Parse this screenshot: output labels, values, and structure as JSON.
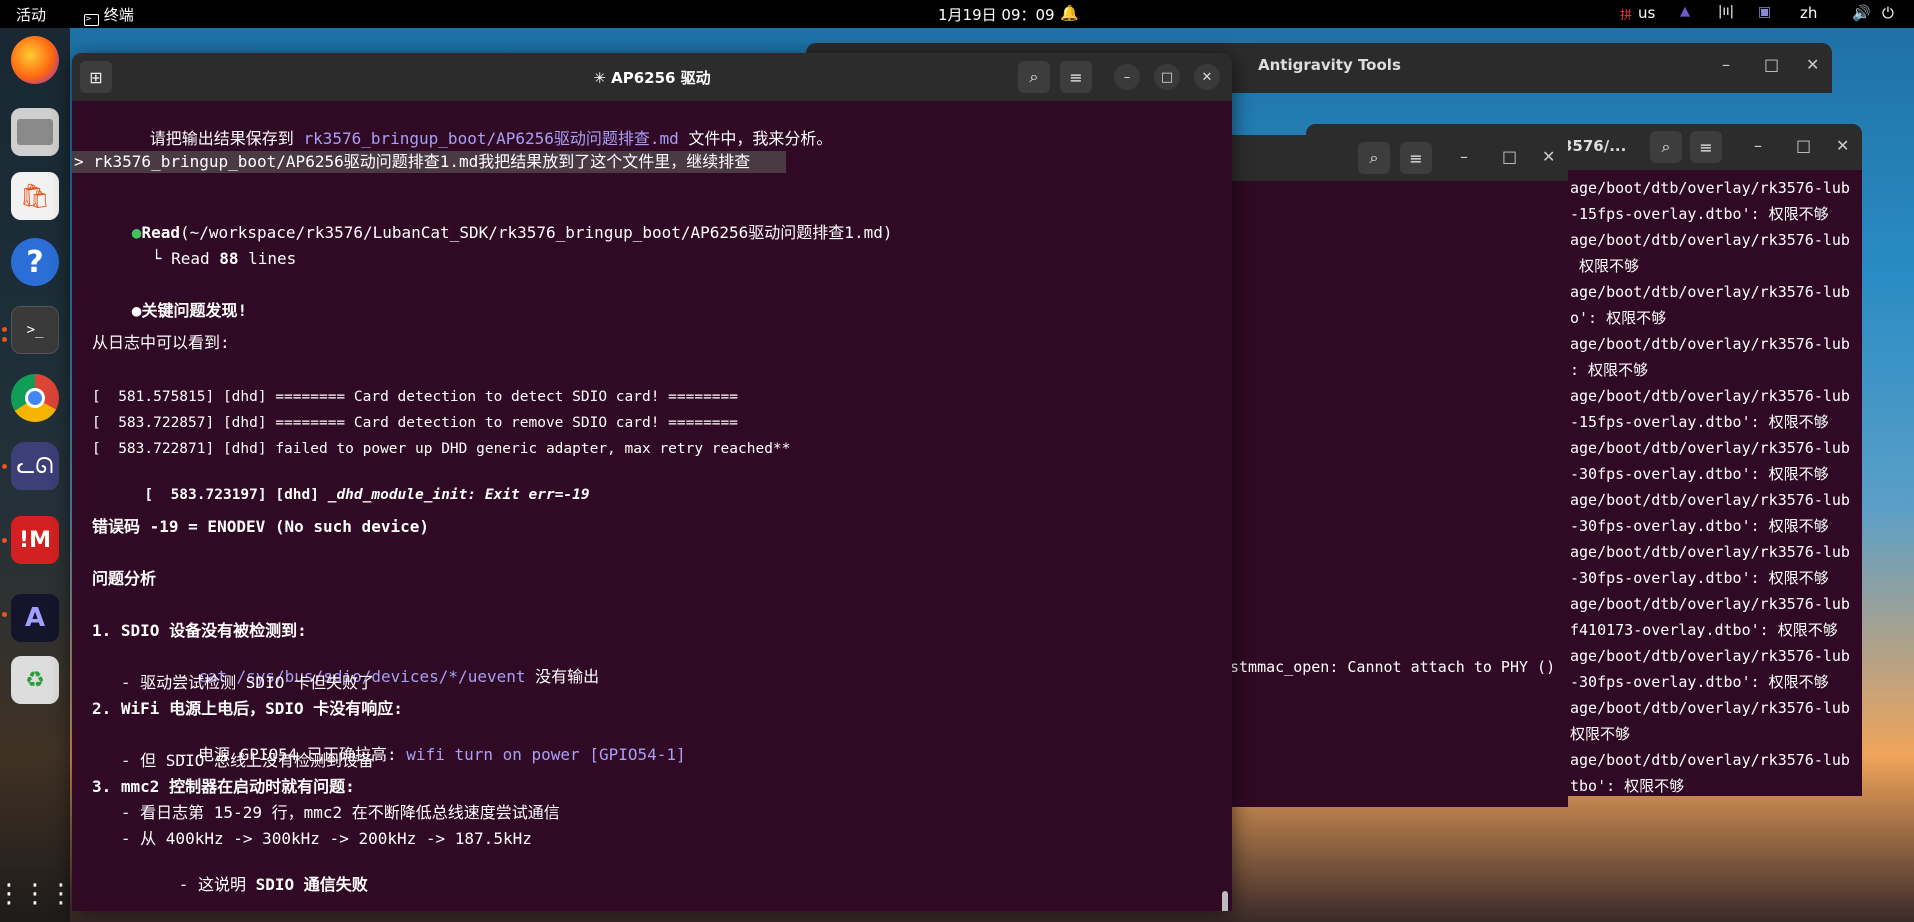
{
  "topbar": {
    "activities": "活动",
    "app_name": "终端",
    "clock": "1月19日  09：09",
    "keyboard_layout": "us",
    "language": "zh"
  },
  "windows": {
    "antigravity": {
      "title": "Antigravity Tools"
    },
    "right_terminal": {
      "title_fragment": "3576/..."
    },
    "middle_terminal": {
      "visible_line": "stmmac_open: Cannot attach to PHY ()"
    },
    "main_terminal": {
      "title": "✳ AP6256 驱动"
    }
  },
  "right_lines": [
    "age/boot/dtb/overlay/rk3576-lub",
    "-15fps-overlay.dtbo': 权限不够",
    "age/boot/dtb/overlay/rk3576-lub",
    " 权限不够",
    "age/boot/dtb/overlay/rk3576-lub",
    "o': 权限不够",
    "age/boot/dtb/overlay/rk3576-lub",
    ": 权限不够",
    "age/boot/dtb/overlay/rk3576-lub",
    "-15fps-overlay.dtbo': 权限不够",
    "age/boot/dtb/overlay/rk3576-lub",
    "-30fps-overlay.dtbo': 权限不够",
    "age/boot/dtb/overlay/rk3576-lub",
    "-30fps-overlay.dtbo': 权限不够",
    "age/boot/dtb/overlay/rk3576-lub",
    "-30fps-overlay.dtbo': 权限不够",
    "age/boot/dtb/overlay/rk3576-lub",
    "f410173-overlay.dtbo': 权限不够",
    "age/boot/dtb/overlay/rk3576-lub",
    "-30fps-overlay.dtbo': 权限不够",
    "age/boot/dtb/overlay/rk3576-lub",
    "权限不够",
    "age/boot/dtb/overlay/rk3576-lub",
    "tbo': 权限不够"
  ],
  "terminal": {
    "l1_a": "请把输出结果保存到 ",
    "l1_path": "rk3576_bringup_boot/AP6256驱动问题排查.md",
    "l1_b": " 文件中，我来分析。",
    "prompt": "> rk3576_bringup_boot/AP6256驱动问题排查1.md我把结果放到了这个文件里，继续排查",
    "read_label": "Read",
    "read_path": "(~/workspace/rk3576/LubanCat_SDK/rk3576_bringup_boot/AP6256驱动问题排查1.md)",
    "read_result_a": "└ Read ",
    "read_result_n": "88",
    "read_result_b": " lines",
    "key_title": "关键问题发现!",
    "log_intro": "从日志中可以看到:",
    "log1": "[  581.575815] [dhd] ======== Card detection to detect SDIO card! ========",
    "log2": "[  583.722857] [dhd] ======== Card detection to remove SDIO card! ========",
    "log3": "[  583.722871] [dhd] failed to power up DHD generic adapter, max retry reached**",
    "log4_a": "[  583.723197] [dhd] ",
    "log4_b": "_dhd_module_init: Exit err=-19",
    "errcode": "错误码 -19 = ENODEV (No such device)",
    "analysis": "问题分析",
    "p1": "1. SDIO 设备没有被检测到:",
    "p1a_a": "   - ",
    "p1a_cmd": "cat /sys/bus/sdio/devices/*/uevent",
    "p1a_b": " 没有输出",
    "p1b": "   - 驱动尝试检测 SDIO 卡但失败了",
    "p2": "2. WiFi 电源上电后，SDIO 卡没有响应:",
    "p2a_a": "   - 电源 GPIO54 已正确拉高: ",
    "p2a_b": "wifi turn on power [GPIO54-1]",
    "p2b": "   - 但 SDIO 总线上没有检测到设备",
    "p3": "3. mmc2 控制器在启动时就有问题:",
    "p3a": "   - 看日志第 15-29 行，mmc2 在不断降低总线速度尝试通信",
    "p3b": "   - 从 400kHz -> 300kHz -> 200kHz -> 187.5kHz",
    "p3c_a": "   - 这说明 ",
    "p3c_b": "SDIO 通信失败"
  }
}
